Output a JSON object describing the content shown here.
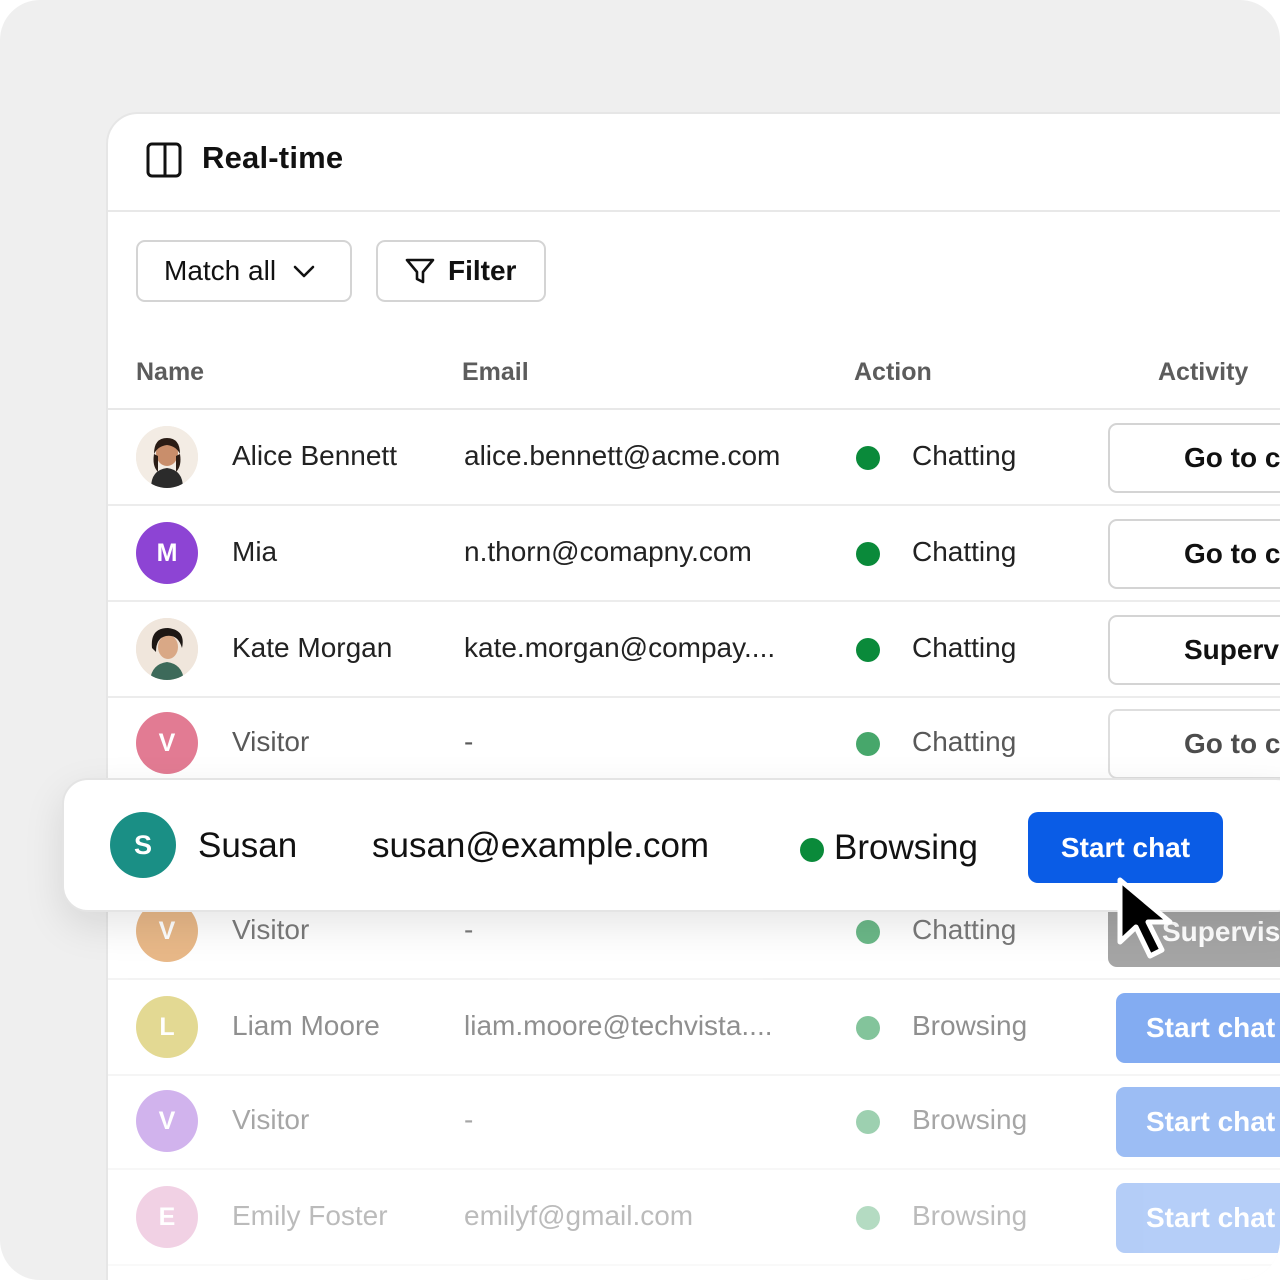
{
  "header": {
    "icon": "sidebar-panel-icon",
    "title": "Real-time"
  },
  "toolbar": {
    "match_label": "Match all",
    "filter_label": "Filter"
  },
  "table": {
    "columns": [
      "Name",
      "Email",
      "Action",
      "Activity"
    ],
    "rows": [
      {
        "name": "Alice Bennett",
        "email": "alice.bennett@acme.com",
        "action": "Chatting",
        "status_color": "#0a8a3a",
        "button": "Go to chat",
        "avatar": "photo",
        "avatar_color": "#f3ece4"
      },
      {
        "name": "Mia",
        "email": "n.thorn@comapny.com",
        "action": "Chatting",
        "status_color": "#0a8a3a",
        "button": "Go to chat",
        "avatar": "M",
        "avatar_color": "#8d44d4"
      },
      {
        "name": "Kate Morgan",
        "email": "kate.morgan@compay....",
        "action": "Chatting",
        "status_color": "#0a8a3a",
        "button": "Supervise",
        "avatar": "photo",
        "avatar_color": "#f0e6dc"
      },
      {
        "name": "Visitor",
        "email": "-",
        "action": "Chatting",
        "status_color": "#0a8a3a",
        "button": "Go to chat",
        "avatar": "V",
        "avatar_color": "#d9506f"
      },
      {
        "name": "Visitor",
        "email": "-",
        "action": "Chatting",
        "status_color": "#0a8a3a",
        "button": "Supervise",
        "avatar": "V",
        "avatar_color": "#d98a3a"
      },
      {
        "name": "Liam Moore",
        "email": "liam.moore@techvista....",
        "action": "Browsing",
        "status_color": "#0a8a3a",
        "button": "Start chat",
        "avatar": "L",
        "avatar_color": "#c9b42a"
      },
      {
        "name": "Visitor",
        "email": "-",
        "action": "Browsing",
        "status_color": "#0a8a3a",
        "button": "Start chat",
        "avatar": "V",
        "avatar_color": "#8d44d4"
      },
      {
        "name": "Emily Foster",
        "email": "emilyf@gmail.com",
        "action": "Browsing",
        "status_color": "#0a8a3a",
        "button": "Start chat",
        "avatar": "E",
        "avatar_color": "#d26aa8"
      }
    ]
  },
  "focus_row": {
    "avatar": "S",
    "avatar_color": "#1a8f85",
    "name": "Susan",
    "email": "susan@example.com",
    "action": "Browsing",
    "status_color": "#0a8a3a",
    "button": "Start chat"
  },
  "colors": {
    "primary": "#0a5ce6",
    "status_green": "#0a8a3a",
    "supervise_gray": "#6b6b6b"
  }
}
